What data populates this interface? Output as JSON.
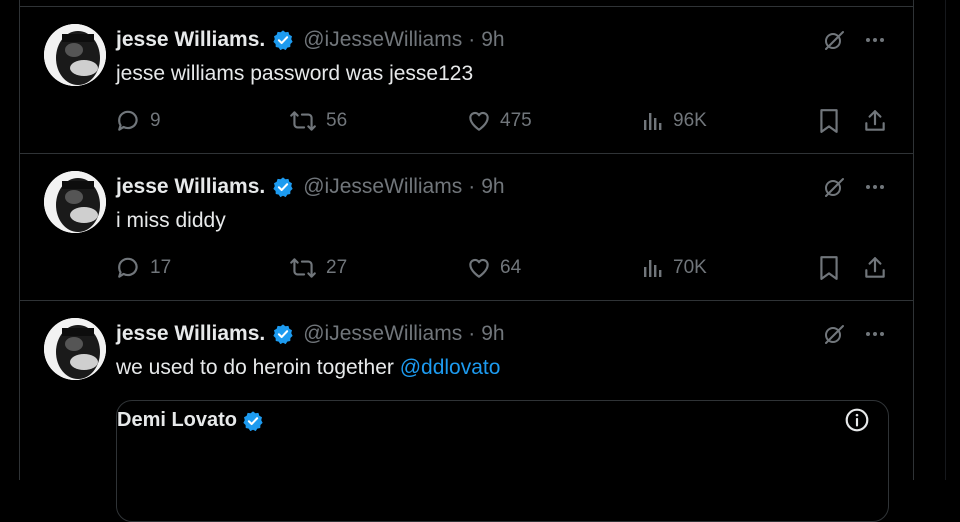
{
  "colors": {
    "background": "#000000",
    "text": "#e7e9ea",
    "secondary": "#71767b",
    "accent": "#1d9bf0",
    "border": "#2f3336"
  },
  "tweets": [
    {
      "display_name": "jesse Williams.",
      "handle": "@iJesseWilliams",
      "separator": "·",
      "time": "9h",
      "text": "jesse williams password was jesse123",
      "replies": "9",
      "reposts": "56",
      "likes": "475",
      "views": "96K"
    },
    {
      "display_name": "jesse Williams.",
      "handle": "@iJesseWilliams",
      "separator": "·",
      "time": "9h",
      "text": "i miss diddy",
      "replies": "17",
      "reposts": "27",
      "likes": "64",
      "views": "70K"
    },
    {
      "display_name": "jesse Williams.",
      "handle": "@iJesseWilliams",
      "separator": "·",
      "time": "9h",
      "text": "we used to do heroin together ",
      "mention": "@ddlovato",
      "quote": {
        "display_name": "Demi Lovato"
      }
    }
  ],
  "icons": {
    "verified": "verified-badge-icon",
    "grok": "grok-icon",
    "more": "more-icon",
    "reply": "reply-icon",
    "repost": "repost-icon",
    "like": "like-icon",
    "views": "views-icon",
    "bookmark": "bookmark-icon",
    "share": "share-icon",
    "info": "info-icon"
  }
}
